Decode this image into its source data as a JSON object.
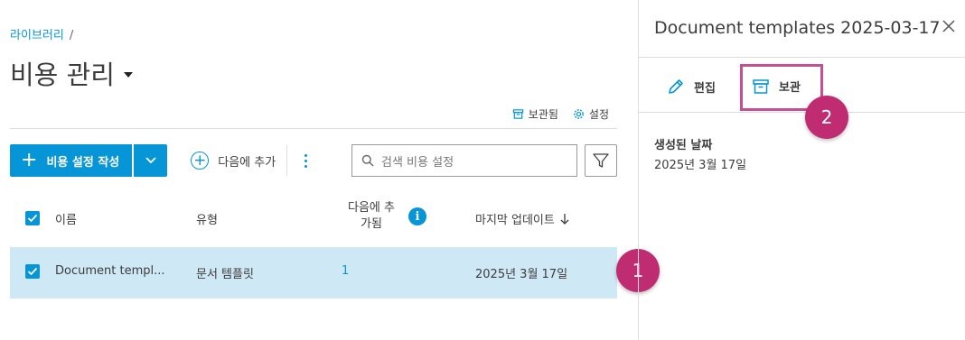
{
  "breadcrumb": {
    "item": "라이브러리",
    "separator": "/"
  },
  "page": {
    "title": "비용 관리"
  },
  "top_links": {
    "archived": "보관됨",
    "settings": "설정"
  },
  "toolbar": {
    "create_label": "비용 설정 작성",
    "add_to_label": "다음에 추가",
    "search_placeholder": "검색 비용 설정"
  },
  "table": {
    "headers": {
      "name": "이름",
      "type": "유형",
      "added_to_line1": "다음에 추",
      "added_to_line2": "가됨",
      "info_icon": "i",
      "last_updated": "마지막 업데이트"
    },
    "rows": [
      {
        "name": "Document templ...",
        "type": "문서 템플릿",
        "added_to": "1",
        "last_updated": "2025년 3월 17일",
        "selected": true
      }
    ]
  },
  "panel": {
    "title": "Document templates 2025-03-17",
    "edit_label": "편집",
    "archive_label": "보관",
    "created_label": "생성된 날짜",
    "created_value": "2025년 3월 17일"
  },
  "badges": {
    "one": "1",
    "two": "2"
  },
  "colors": {
    "accent": "#0696d7",
    "selected_row": "#cfe8f5",
    "badge": "#c02c72",
    "highlight": "#c44f95"
  },
  "icons": [
    "archive-icon",
    "gear-icon",
    "plus-icon",
    "chevron-down-icon",
    "add-circle-icon",
    "kebab-icon",
    "search-icon",
    "filter-icon",
    "check-icon",
    "info-icon",
    "arrow-down-icon",
    "close-icon",
    "pencil-icon"
  ]
}
